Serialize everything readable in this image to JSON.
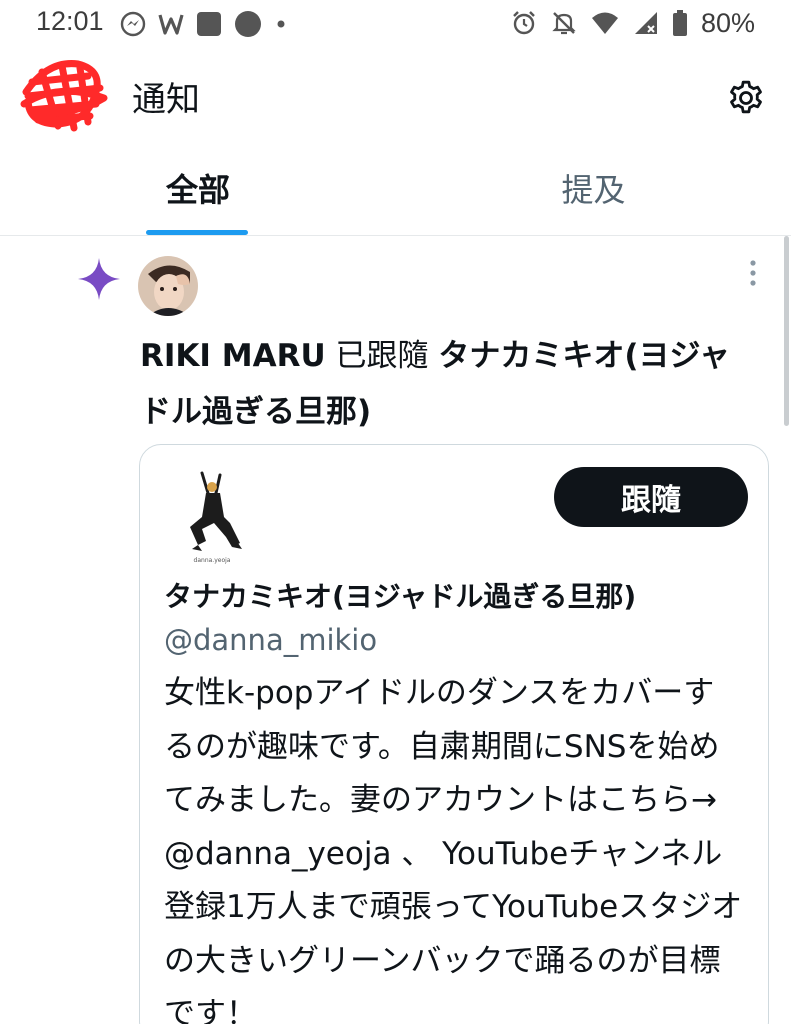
{
  "status_bar": {
    "time": "12:01",
    "battery": "80%",
    "left_icons": [
      "messenger-icon",
      "w-app-icon",
      "square-app-icon",
      "circle-app-icon",
      "dot-icon"
    ],
    "right_icons": [
      "alarm-icon",
      "mute-icon",
      "wifi-icon",
      "signal-icon",
      "battery-icon"
    ]
  },
  "header": {
    "title": "通知",
    "settings_icon": "gear-icon",
    "avatar_redaction_color": "#ff2a2a"
  },
  "tabs": [
    {
      "label": "全部",
      "active": true
    },
    {
      "label": "提及",
      "active": false
    }
  ],
  "accent_color": "#1d9bf0",
  "notification": {
    "type_icon": "sparkle-icon",
    "type_icon_color": "#794bc4",
    "follower_name": "RIKI MARU",
    "action": " 已跟隨 ",
    "followed_name": "タナカミキオ(ヨジャドル過ぎる旦那)",
    "card": {
      "follow_label": "跟隨",
      "name": "タナカミキオ(ヨジャドル過ぎる旦那)",
      "handle": "@danna_mikio",
      "bio": "女性k-popアイドルのダンスをカバーするのが趣味です。自粛期間にSNSを始めてみました。妻のアカウントはこちら→ @danna_yeoja 、 YouTubeチャンネル登録1万人まで頑張ってYouTubeスタジオの大きいグリーンバックで踊るのが目標です！",
      "avatar_caption": "danna.yeoja"
    }
  }
}
